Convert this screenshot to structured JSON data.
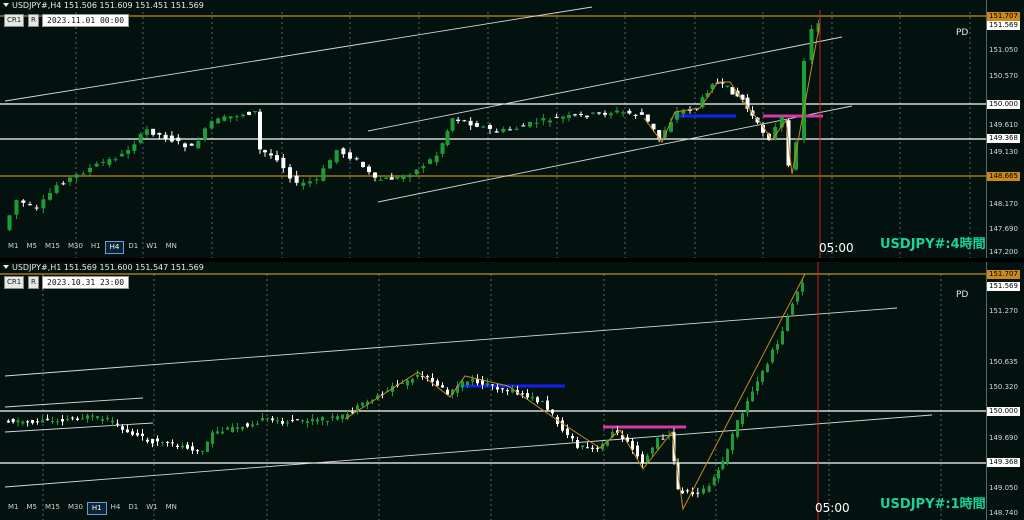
{
  "top": {
    "title": "USDJPY#,H4  151.506 151.609 151.451 151.569",
    "cr_label": "CR1",
    "r_label": "R",
    "date": "2023.11.01 00:00",
    "pd": "PD",
    "symbol_label": "USDJPY#:4時間",
    "time_label": "05:00",
    "timeframes": [
      "M1",
      "M5",
      "M15",
      "M30",
      "H1",
      "H4",
      "D1",
      "W1",
      "MN"
    ],
    "active_timeframe": "H4",
    "price_labels": [
      "151.050",
      "150.570",
      "149.610",
      "149.130",
      "148.170",
      "147.690",
      "147.200"
    ],
    "tags": [
      {
        "text": "151.707",
        "kind": "orange"
      },
      {
        "text": "151.569",
        "kind": "white"
      },
      {
        "text": "150.000",
        "kind": "white"
      },
      {
        "text": "149.368",
        "kind": "white"
      },
      {
        "text": "148.665",
        "kind": "orange"
      }
    ]
  },
  "bottom": {
    "title": "USDJPY#,H1  151.569 151.600 151.547 151.569",
    "cr_label": "CR1",
    "r_label": "R",
    "date": "2023.10.31 23:00",
    "pd": "PD",
    "symbol_label": "USDJPY#:1時間",
    "time_label": "05:00",
    "timeframes": [
      "M1",
      "M5",
      "M15",
      "M30",
      "H1",
      "H4",
      "D1",
      "W1",
      "MN"
    ],
    "active_timeframe": "H1",
    "price_labels": [
      "151.270",
      "150.635",
      "150.320",
      "149.690",
      "149.050",
      "148.740"
    ],
    "tags": [
      {
        "text": "151.707",
        "kind": "orange"
      },
      {
        "text": "151.569",
        "kind": "white"
      },
      {
        "text": "150.000",
        "kind": "white"
      },
      {
        "text": "149.368",
        "kind": "white"
      }
    ]
  },
  "colors": {
    "bg": "#03120f",
    "bull": "#1e9c38",
    "bear": "#ffffff",
    "orange": "#c98a1a",
    "blue": "#1122ee",
    "magenta": "#d63aa6",
    "green_label": "#19d39a"
  }
}
